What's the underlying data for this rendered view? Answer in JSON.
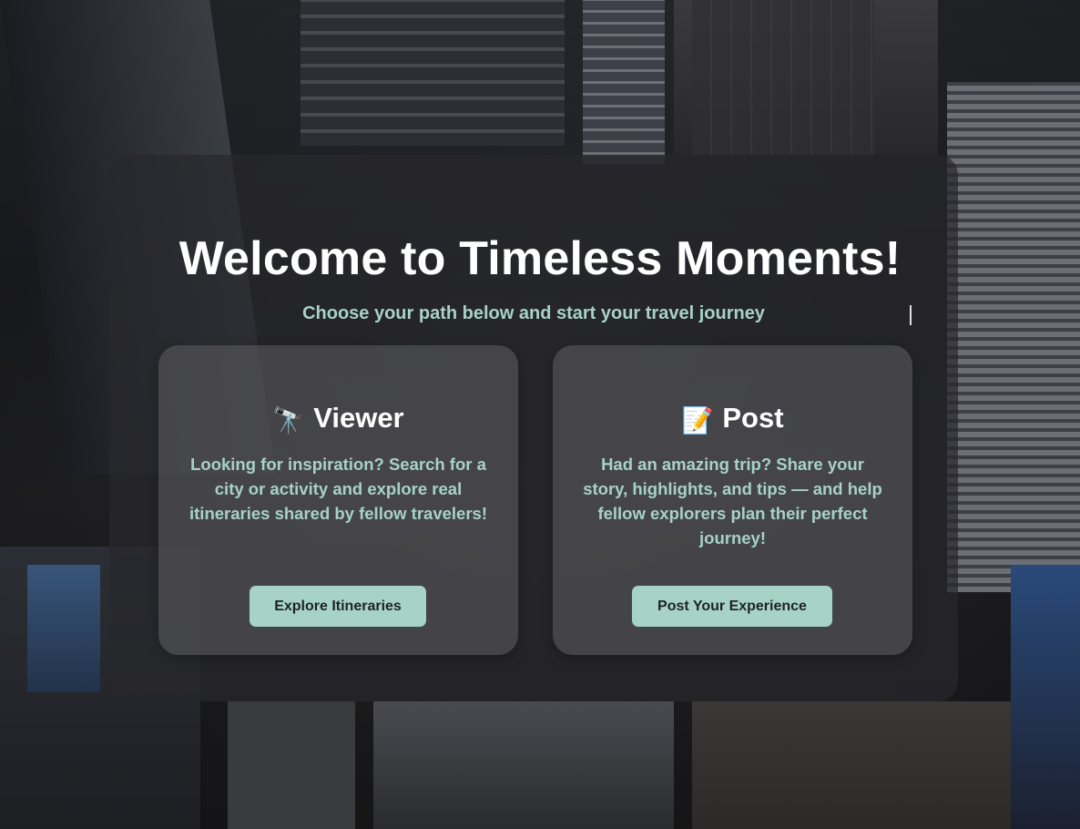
{
  "hero": {
    "title": "Welcome to Timeless Moments!",
    "subtitle": "Choose your path below and start your travel journey"
  },
  "cards": [
    {
      "icon": "telescope-icon",
      "icon_glyph": "🔭",
      "heading": "Viewer",
      "description": "Looking for inspiration? Search for a city or activity and explore real itineraries shared by fellow travelers!",
      "button_label": "Explore Itineraries"
    },
    {
      "icon": "memo-icon",
      "icon_glyph": "📝",
      "heading": "Post",
      "description": "Had an amazing trip? Share your story, highlights, and tips — and help fellow explorers plan their perfect journey!",
      "button_label": "Post Your Experience"
    }
  ],
  "colors": {
    "accent": "#a7d2c6",
    "title": "#ffffff",
    "button_text": "#1e2326"
  }
}
